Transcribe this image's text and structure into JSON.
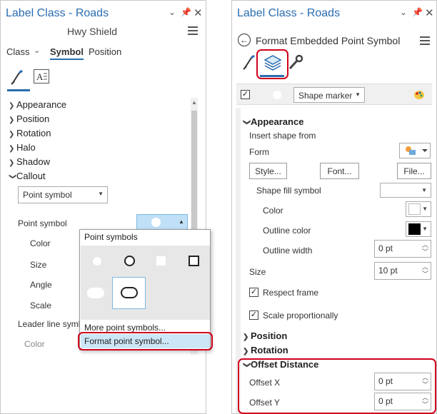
{
  "left_panel": {
    "title": "Label Class - Roads",
    "subtitle": "Hwy Shield",
    "tabs": [
      "Class",
      "Symbol",
      "Position"
    ],
    "sections": [
      "Appearance",
      "Position",
      "Rotation",
      "Halo",
      "Shadow",
      "Callout"
    ],
    "callout_value": "Point symbol",
    "rows": {
      "point_symbol": "Point symbol",
      "color": "Color",
      "size": "Size",
      "angle": "Angle",
      "scale": "Scale",
      "leader_line": "Leader line symb",
      "color2": "Color"
    },
    "popup": {
      "header": "Point symbols",
      "more": "More point symbols...",
      "format": "Format point symbol..."
    }
  },
  "right_panel": {
    "title": "Label Class - Roads",
    "subtitle": "Format Embedded Point Symbol",
    "marker_type": "Shape marker",
    "appearance": "Appearance",
    "insert_shape_from": "Insert shape from",
    "form_label": "Form",
    "buttons": [
      "Style...",
      "Font...",
      "File..."
    ],
    "shape_fill_symbol": "Shape fill symbol",
    "color": "Color",
    "outline_color": "Outline color",
    "outline_width": "Outline width",
    "outline_width_value": "0 pt",
    "size": "Size",
    "size_value": "10 pt",
    "respect_frame": "Respect frame",
    "scale_proportionally": "Scale proportionally",
    "position": "Position",
    "rotation": "Rotation",
    "offset_distance": "Offset Distance",
    "offset_x": "Offset X",
    "offset_x_value": "0 pt",
    "offset_y": "Offset Y",
    "offset_y_value": "0 pt"
  },
  "colors": {
    "accent": "#2a6db0",
    "highlight": "#d0021b",
    "outline_swatch": "#000000"
  },
  "icons": [
    "chevron-down-icon",
    "pin-icon",
    "close-icon",
    "menu-icon",
    "back-icon",
    "brush-icon",
    "layers-icon",
    "wrench-icon",
    "palette-icon"
  ]
}
